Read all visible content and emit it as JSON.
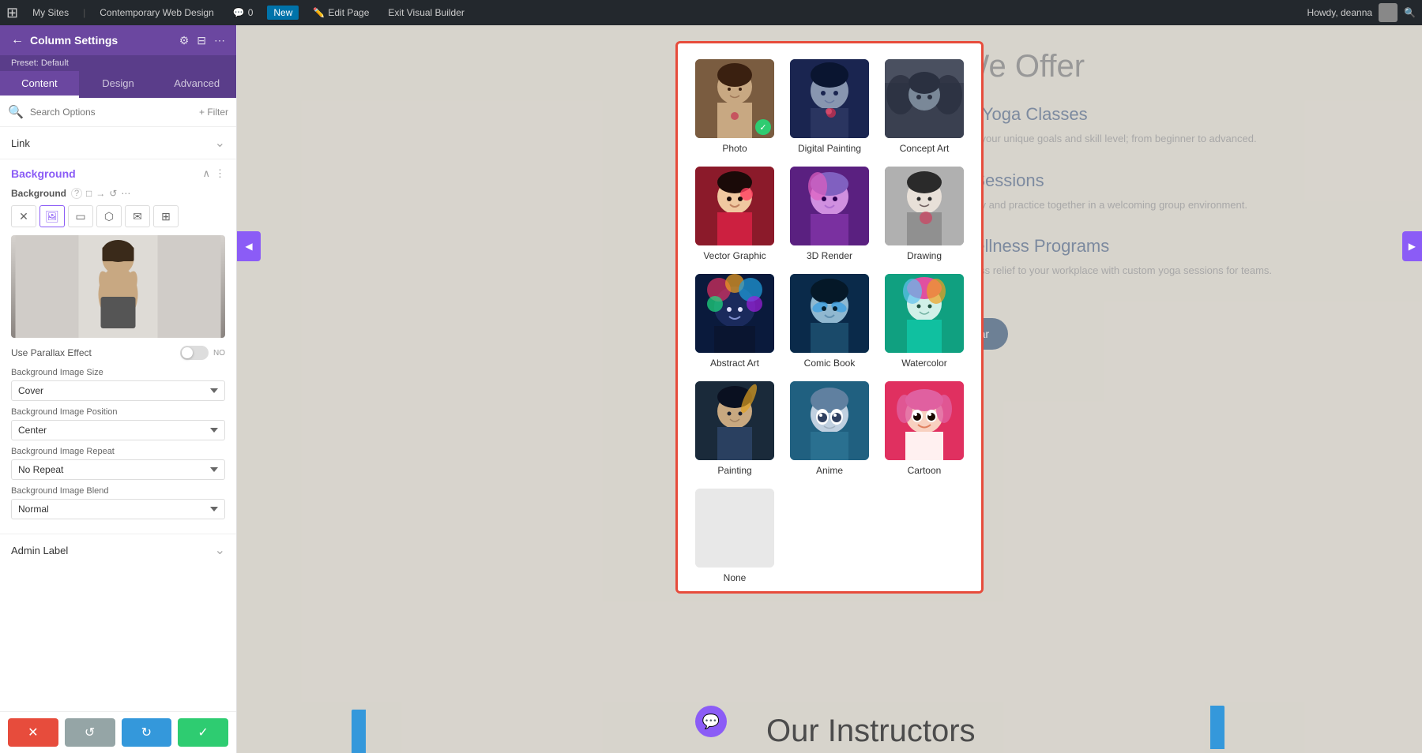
{
  "adminBar": {
    "wpLogo": "⊞",
    "mySites": "My Sites",
    "siteName": "Contemporary Web Design",
    "comments": "0",
    "new": "New",
    "editPage": "Edit Page",
    "exitBuilder": "Exit Visual Builder",
    "howdy": "Howdy, deanna",
    "searchIcon": "🔍"
  },
  "sidebar": {
    "title": "Column Settings",
    "backIcon": "←",
    "preset": "Preset: Default",
    "tabs": [
      "Content",
      "Design",
      "Advanced"
    ],
    "activeTab": "Content",
    "search": {
      "placeholder": "Search Options",
      "filterLabel": "+ Filter"
    },
    "link": {
      "label": "Link",
      "collapseIcon": "⌄"
    },
    "background": {
      "title": "Background",
      "sectionLabel": "Background",
      "helpIcon": "?",
      "copyIcon": "□",
      "pasteIcon": "→",
      "resetIcon": "↺",
      "moreIcon": "⋯",
      "types": [
        "gradient",
        "image",
        "video",
        "mask",
        "pattern",
        "responsive"
      ],
      "parallax": {
        "label": "Use Parallax Effect",
        "value": "NO"
      },
      "imageSize": {
        "label": "Background Image Size",
        "value": "Cover"
      },
      "imagePosition": {
        "label": "Background Image Position",
        "value": "Center"
      },
      "imageRepeat": {
        "label": "Background Image Repeat",
        "value": "No Repeat"
      },
      "imageBlend": {
        "label": "Background Image Blend",
        "value": "Normal"
      }
    },
    "adminLabel": {
      "label": "Admin Label"
    },
    "bottomActions": {
      "cancel": "✕",
      "reset": "↺",
      "saveDraft": "↻",
      "save": "✓"
    }
  },
  "modal": {
    "styles": [
      {
        "id": "photo",
        "label": "Photo",
        "selected": true,
        "thumbClass": "thumb-photo"
      },
      {
        "id": "digital-painting",
        "label": "Digital Painting",
        "selected": false,
        "thumbClass": "thumb-digital"
      },
      {
        "id": "concept-art",
        "label": "Concept Art",
        "selected": false,
        "thumbClass": "thumb-concept"
      },
      {
        "id": "vector-graphic",
        "label": "Vector Graphic",
        "selected": false,
        "thumbClass": "thumb-vector"
      },
      {
        "id": "3d-render",
        "label": "3D Render",
        "selected": false,
        "thumbClass": "thumb-3d"
      },
      {
        "id": "drawing",
        "label": "Drawing",
        "selected": false,
        "thumbClass": "thumb-drawing"
      },
      {
        "id": "abstract-art",
        "label": "Abstract Art",
        "selected": false,
        "thumbClass": "thumb-abstract"
      },
      {
        "id": "comic-book",
        "label": "Comic Book",
        "selected": false,
        "thumbClass": "thumb-comic"
      },
      {
        "id": "watercolor",
        "label": "Watercolor",
        "selected": false,
        "thumbClass": "thumb-watercolor"
      },
      {
        "id": "painting",
        "label": "Painting",
        "selected": false,
        "thumbClass": "thumb-painting"
      },
      {
        "id": "anime",
        "label": "Anime",
        "selected": false,
        "thumbClass": "thumb-anime"
      },
      {
        "id": "cartoon",
        "label": "Cartoon",
        "selected": false,
        "thumbClass": "thumb-cartoon"
      },
      {
        "id": "none",
        "label": "None",
        "selected": false,
        "thumbClass": "thumb-none"
      }
    ]
  },
  "mainContent": {
    "whatWeOffer": "What We Offer",
    "services": [
      {
        "title": "Personalized Yoga Classes",
        "desc": "Tailored sessions to fit your unique goals and skill level; from beginner to advanced."
      },
      {
        "title": "Group Yoga Sessions",
        "desc": "A supportive community and practice together in a welcoming group environment."
      },
      {
        "title": "Corporate Wellness Programs",
        "desc": "Bring balance and stress relief to your workplace with custom yoga sessions for teams."
      }
    ],
    "viewCalendar": "View Our Calendar",
    "ourInstructors": "Our Instructors"
  }
}
